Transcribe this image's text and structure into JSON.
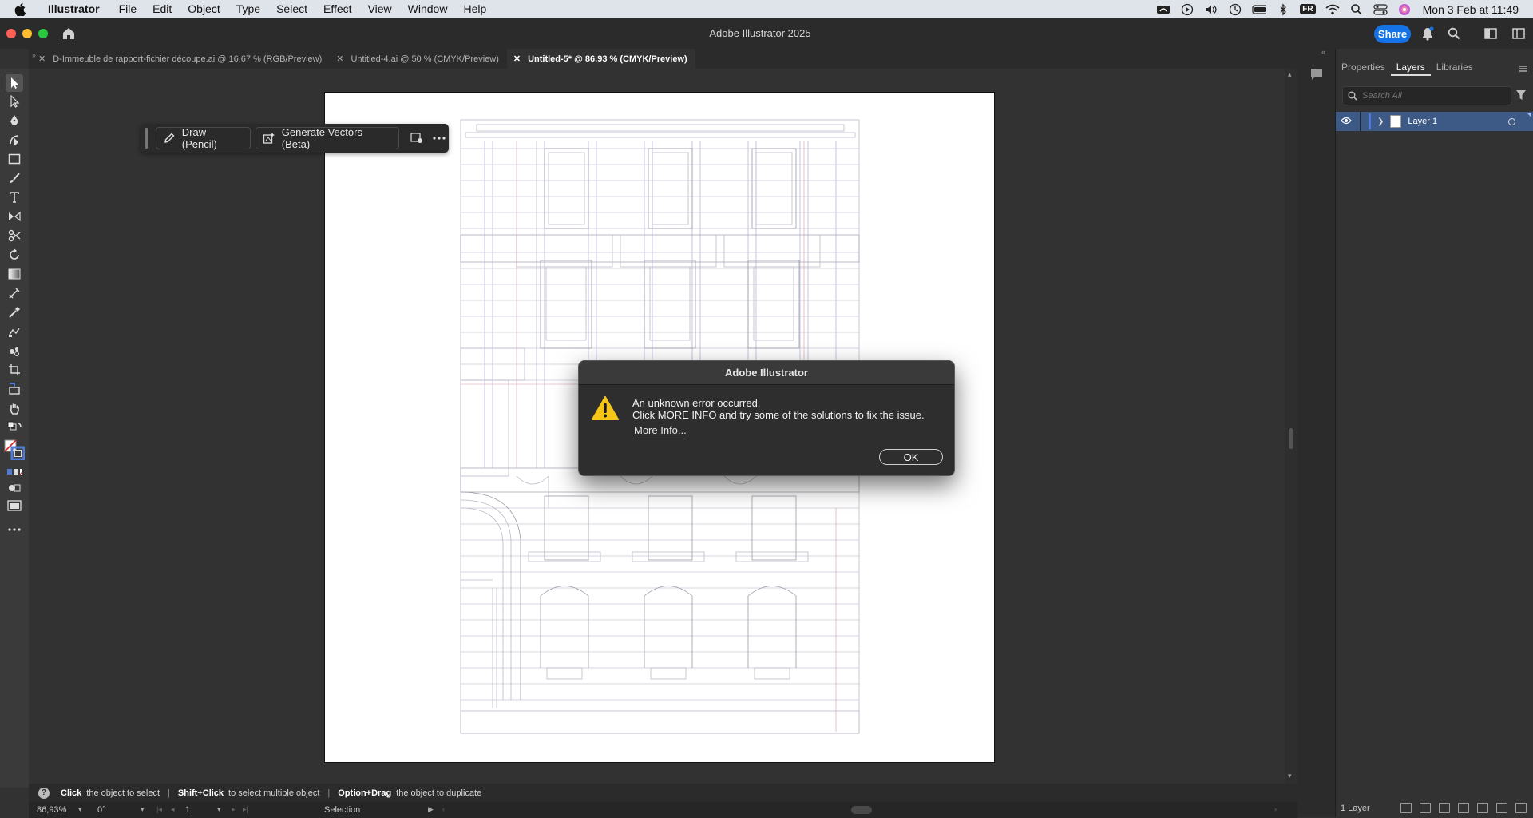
{
  "menubar": {
    "app_name": "Illustrator",
    "items": [
      "File",
      "Edit",
      "Object",
      "Type",
      "Select",
      "Effect",
      "View",
      "Window",
      "Help"
    ],
    "input_source": "FR",
    "clock": "Mon 3 Feb at 11:49"
  },
  "titlebar": {
    "title": "Adobe Illustrator 2025",
    "share_label": "Share"
  },
  "tabs": [
    {
      "label": "D-Immeuble de rapport-fichier découpe.ai @ 16,67 % (RGB/Preview)"
    },
    {
      "label": "Untitled-4.ai @ 50 % (CMYK/Preview)"
    },
    {
      "label": "Untitled-5* @ 86,93 % (CMYK/Preview)"
    }
  ],
  "taskbar": {
    "draw_label": "Draw (Pencil)",
    "generate_label": "Generate Vectors (Beta)"
  },
  "right_panel": {
    "tabs": [
      "Properties",
      "Layers",
      "Libraries"
    ],
    "search_placeholder": "Search All",
    "layer_name": "Layer 1",
    "footer_count": "1 Layer"
  },
  "hint_bar": {
    "part1_bold": "Click",
    "part1": "the object to select",
    "part2_bold": "Shift+Click",
    "part2": "to select multiple object",
    "part3_bold": "Option+Drag",
    "part3": "the object to duplicate"
  },
  "bottom_bar": {
    "zoom": "86,93%",
    "rotation": "0°",
    "page": "1",
    "mode": "Selection"
  },
  "dialog": {
    "title": "Adobe Illustrator",
    "message_line1": "An unknown error occurred.",
    "message_line2": "Click MORE INFO and try some of the solutions to fix the issue.",
    "more_info": "More Info...",
    "ok_label": "OK"
  },
  "colors": {
    "accent_blue": "#1473e6",
    "layer_selected": "#3d5a86",
    "warning_yellow": "#f5c518",
    "traffic_red": "#fe5f57",
    "traffic_yellow": "#febc2e",
    "traffic_green": "#28c840"
  }
}
